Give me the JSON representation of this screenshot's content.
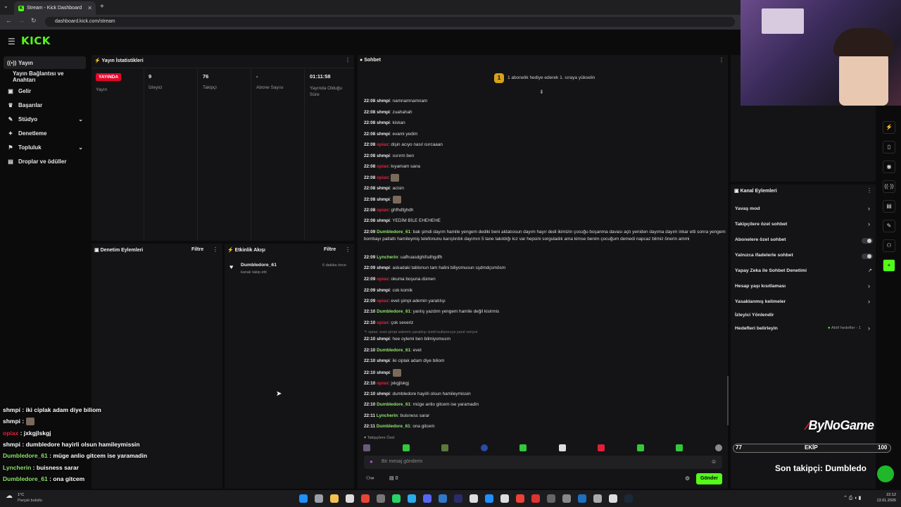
{
  "browser": {
    "tab_title": "Stream - Kick Dashboard",
    "url": "dashboard.kick.com/stream"
  },
  "header": {
    "logo": "KICK"
  },
  "sidebar": {
    "items": [
      {
        "label": "Yayın",
        "icon": "broadcast-icon"
      },
      {
        "label": "Yayın Bağlantısı ve Anahtarı",
        "icon": ""
      },
      {
        "label": "Gelir",
        "icon": "money-icon"
      },
      {
        "label": "Başarılar",
        "icon": "trophy-icon"
      },
      {
        "label": "Stüdyo",
        "icon": "studio-icon"
      },
      {
        "label": "Denetleme",
        "icon": "wrench-icon"
      },
      {
        "label": "Topluluk",
        "icon": "community-icon"
      },
      {
        "label": "Droplar ve ödüller",
        "icon": "gift-icon"
      }
    ]
  },
  "stats": {
    "title": "Yayın İstatistikleri",
    "live_badge": "YAYINDA",
    "items": [
      {
        "value": "",
        "label": "Yayın"
      },
      {
        "value": "9",
        "label": "İzleyici"
      },
      {
        "value": "76",
        "label": "Takipçi"
      },
      {
        "value": "-",
        "label": "Abone Sayısı"
      },
      {
        "value": "01:11:58",
        "label": "Yayında Olduğu Süre"
      }
    ]
  },
  "moderation": {
    "title": "Denetim Eylemleri",
    "filter": "Filtre"
  },
  "activity": {
    "title": "Etkinlik Akışı",
    "filter": "Filtre",
    "event_user": "Dumbledore_61",
    "event_action": "kanalı takip etti",
    "event_time": "6 dakika önce"
  },
  "chat": {
    "title": "Sohbet",
    "banner": "1 abonelik hediye ederek 1. sıraya yükselin",
    "messages": [
      {
        "t": "22:08",
        "u": "shmpi",
        "c": "#f0f0f0",
        "m": "namnamnamnam"
      },
      {
        "t": "22:08",
        "u": "shmpi",
        "c": "#f0f0f0",
        "m": "zuahahah"
      },
      {
        "t": "22:08",
        "u": "shmpi",
        "c": "#f0f0f0",
        "m": "kiskan"
      },
      {
        "t": "22:08",
        "u": "shmpi",
        "c": "#f0f0f0",
        "m": "evami yedim"
      },
      {
        "t": "22:08",
        "u": "opiax",
        "c": "#e5213f",
        "m": "dişin acıyo nasıl ısırcaaan"
      },
      {
        "t": "22:08",
        "u": "shmpi",
        "c": "#f0f0f0",
        "m": "ısırırm ben"
      },
      {
        "t": "22:08",
        "u": "opiax",
        "c": "#e5213f",
        "m": "kıyamam sana"
      },
      {
        "t": "22:08",
        "u": "opiax",
        "c": "#e5213f",
        "m": "",
        "emote": true
      },
      {
        "t": "22:08",
        "u": "shmpi",
        "c": "#f0f0f0",
        "m": "acisin"
      },
      {
        "t": "22:08",
        "u": "shmpi",
        "c": "#f0f0f0",
        "m": "",
        "emote": true
      },
      {
        "t": "22:08",
        "u": "opiax",
        "c": "#e5213f",
        "m": "ghfhdfghdh"
      },
      {
        "t": "22:08",
        "u": "shmpi",
        "c": "#f0f0f0",
        "m": "YEDİM BİLE EHEHEHE"
      },
      {
        "t": "22:09",
        "u": "Dumbledore_61",
        "c": "#8fe36b",
        "m": "bak şimdi dayım hamile yengem dediki beni aldatıosun dayım hayır dedi ikimizin çocuğu boşanma davası açtı yeniden dayıma dayım inkar etti sonra yengem bombayı patlattı hamileymiş telefonunu karıştırdık dayımın 5 tane takıldığı kız var hepsini sorguladık ama kimse benim çocuğum demedi napcaz bilmiz önerin ammi"
      },
      {
        "t": "22:09",
        "u": "Lyncherin",
        "c": "#8fe36b",
        "m": "uafhuasdghifsdhgdfh"
      },
      {
        "t": "22:09",
        "u": "shmpi",
        "c": "#f0f0f0",
        "m": "askadaki tablonun tam halini biliyomusun sşdmdçsmösm"
      },
      {
        "t": "22:09",
        "u": "opiax",
        "c": "#e5213f",
        "m": "okuma boşuna dümen"
      },
      {
        "t": "22:09",
        "u": "shmpi",
        "c": "#f0f0f0",
        "m": "cok komik"
      },
      {
        "t": "22:09",
        "u": "opiax",
        "c": "#e5213f",
        "m": "evet şimpi ademin yaratılışı"
      },
      {
        "t": "22:10",
        "u": "Dumbledore_61",
        "c": "#8fe36b",
        "m": "yanlış yazdım yengem hamile değil kisirmis"
      },
      {
        "t": "22:10",
        "u": "opiax",
        "c": "#e5213f",
        "m": "çok severiz"
      },
      {
        "t": "22:10",
        "u": "shmpi",
        "c": "#f0f0f0",
        "m": "hee oylemi ben bilmiyomusm"
      },
      {
        "t": "22:10",
        "u": "Dumbledore_61",
        "c": "#8fe36b",
        "m": "evet"
      },
      {
        "t": "22:10",
        "u": "shmpi",
        "c": "#f0f0f0",
        "m": "iki ciplak adam diye biliom"
      },
      {
        "t": "22:10",
        "u": "shmpi",
        "c": "#f0f0f0",
        "m": "",
        "emote": true
      },
      {
        "t": "22:10",
        "u": "opiax",
        "c": "#e5213f",
        "m": "jxkgjlskgj"
      },
      {
        "t": "22:10",
        "u": "shmpi",
        "c": "#f0f0f0",
        "m": "dumbledore hayirli olsun hamileymissin"
      },
      {
        "t": "22:10",
        "u": "Dumbledore_61",
        "c": "#8fe36b",
        "m": "müge anlio gitcem ise yaramadin"
      },
      {
        "t": "22:11",
        "u": "Lyncherin",
        "c": "#8fe36b",
        "m": "buisness sarar"
      },
      {
        "t": "22:11",
        "u": "Dumbledore_61",
        "c": "#8fe36b",
        "m": "ona gitcem"
      }
    ],
    "reply_note": "opiax: evet şimpi ademin yaratılışı izimli kullanıcıya yanıt veriyor",
    "followers_only": "Takipçilere Özel",
    "input_placeholder": "Bir mesaj gönderin",
    "send_label": "Gönder",
    "points": "0"
  },
  "channel_actions": {
    "title": "Kanal Eylemleri",
    "items": [
      {
        "label": "Yavaş mod",
        "ctl": "arrow"
      },
      {
        "label": "Takipçilere özel sohbet",
        "ctl": "arrow"
      },
      {
        "label": "Abonelere özel sohbet",
        "ctl": "toggle"
      },
      {
        "label": "Yalnızca ifadelerle sohbet",
        "ctl": "toggle"
      },
      {
        "label": "Yapay Zeka ile Sohbet Denetimi",
        "ctl": "link"
      },
      {
        "label": "Hesap yaşı kısıtlaması",
        "ctl": "arrow"
      },
      {
        "label": "Yasaklanmış kelimeler",
        "ctl": "arrow"
      },
      {
        "label": "İzleyici Yönlendir",
        "ctl": "none"
      },
      {
        "label": "Hedefleri belirleyin",
        "ctl": "arrow"
      }
    ],
    "goals_status": "Aktif hedefler - 1"
  },
  "overlay": {
    "brand": "ByNoGame",
    "team_label": "EKİP",
    "team_left": "77",
    "team_right": "100",
    "last_follower": "Son takipçi: Dumbledore_61",
    "chat": [
      {
        "u": "shmpi",
        "c": "#ffffff",
        "m": "iki ciplak adam diye biliom"
      },
      {
        "u": "shmpi",
        "c": "#ffffff",
        "m": ""
      },
      {
        "u": "opiax",
        "c": "#e5213f",
        "m": "jxkgjlskgj"
      },
      {
        "u": "shmpi",
        "c": "#ffffff",
        "m": "dumbledore hayirli olsun hamileymissin"
      },
      {
        "u": "Dumbledore_61",
        "c": "#8fe36b",
        "m": "müge anlio gitcem ise yaramadin"
      },
      {
        "u": "Lyncherin",
        "c": "#8fe36b",
        "m": "buisness sarar"
      },
      {
        "u": "Dumbledore_61",
        "c": "#8fe36b",
        "m": "ona gitcem"
      }
    ]
  },
  "taskbar": {
    "weather_temp": "1°C",
    "weather_desc": "Parçalı bulutlu",
    "time": "22:12",
    "date": "13.01.2026"
  }
}
